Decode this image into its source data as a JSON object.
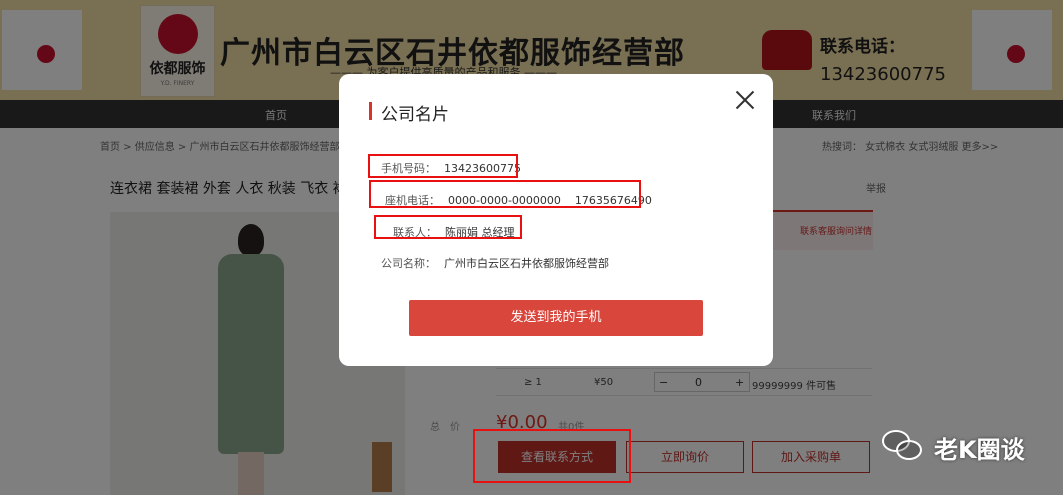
{
  "header": {
    "brand": "依都服饰",
    "brand_sub": "Y.D. FINERY",
    "company_title": "广州市白云区石井依都服饰经营部",
    "slogan": "——— 为客户提供高质量的产品和服务 ———",
    "contact_label": "联系电话：",
    "contact_number": "13423600775"
  },
  "nav": {
    "items": [
      "首页",
      "联系我们"
    ]
  },
  "breadcrumb": "首页  >  供应信息  >  广州市白云区石井依都服饰经营部",
  "hot_search": "热搜词：   女式棉衣     女式羽绒服     更多>>",
  "product": {
    "title": "连衣裙 套装裙 外套 人衣 秋装 飞衣 裙",
    "report": "举报",
    "service_note": "联系客服询问详情",
    "tier_qty": "≥ 1",
    "tier_price": "¥50",
    "stepper_minus": "−",
    "stepper_value": "0",
    "stepper_plus": "+",
    "stock": "99999999 件可售",
    "price_label": "总价",
    "price": "¥0.00",
    "count": "共0件"
  },
  "buttons": {
    "view_contact": "查看联系方式",
    "inquire": "立即询价",
    "add_cart": "加入采购单"
  },
  "modal": {
    "title": "公司名片",
    "mobile_label": "手机号码：",
    "mobile": "13423600775",
    "phone_label": "座机电话：",
    "phone": "0000-0000-0000000",
    "phone2": "17635676490",
    "person_label": "联系人：",
    "person": "陈丽娟  总经理",
    "company_label": "公司名称：",
    "company": "广州市白云区石井依都服饰经营部",
    "send_button": "发送到我的手机"
  },
  "watermark": "老K圈谈",
  "colors": {
    "accent": "#d9342b",
    "annotation": "#e81010",
    "banner": "#f3dfa4"
  }
}
